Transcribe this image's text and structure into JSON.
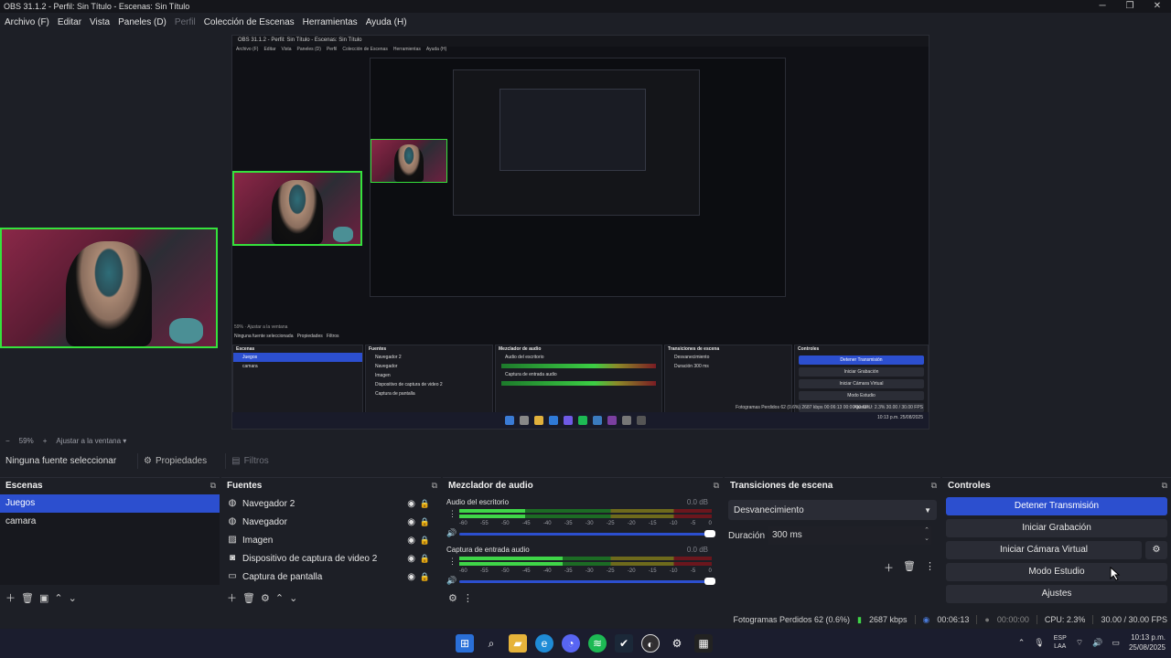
{
  "window": {
    "title": "OBS 31.1.2 - Perfil: Sin Título - Escenas: Sin Título",
    "minimize": "─",
    "maximize": "❐",
    "close": "✕"
  },
  "menu": {
    "archivo": "Archivo (F)",
    "editar": "Editar",
    "vista": "Vista",
    "paneles": "Paneles (D)",
    "perfil": "Perfil",
    "coleccion": "Colección de Escenas",
    "herramientas": "Herramientas",
    "ayuda": "Ayuda (H)"
  },
  "nested_preview": {
    "title": "OBS 31.1.2 - Perfil: Sin Título - Escenas: Sin Título",
    "menu": [
      "Archivo (F)",
      "Editar",
      "Vista",
      "Paneles (D)",
      "Perfil",
      "Colección de Escenas",
      "Herramientas",
      "Ayuda (H)"
    ],
    "zoom": "59%",
    "fit": "Ajustar a la ventana",
    "no_source": "Ninguna fuente seleccionada",
    "props": "Propiedades",
    "filters": "Filtros",
    "scenes_h": "Escenas",
    "scenes": [
      "Juegos",
      "camara"
    ],
    "sources_h": "Fuentes",
    "sources": [
      "Navegador 2",
      "Navegador",
      "Imagen",
      "Dispositivo de captura de video 2",
      "Captura de pantalla"
    ],
    "mixer_h": "Mezclador de audio",
    "mixer": [
      "Audio del escritorio",
      "Captura de entrada audio"
    ],
    "trans_h": "Transiciones de escena",
    "trans": "Desvanecimiento",
    "dur_lbl": "Duración",
    "dur": "300 ms",
    "ctl_h": "Controles",
    "ctl": [
      "Detener Transmisión",
      "Iniciar Grabación",
      "Iniciar Cámara Virtual",
      "Modo Estudio",
      "Ajustes"
    ],
    "status": "Fotogramas Perdidos 62 (0.6%)   2687 kbps   00:06:13   00:00:00   CPU: 2.3%   30.00 / 30.00 FPS",
    "clock": "10:13 p.m. 25/08/2025"
  },
  "zoombar": {
    "zoom": "59%",
    "plus": "+",
    "fit": "Ajustar a la ventana"
  },
  "sourcebar": {
    "none": "Ninguna fuente seleccionar",
    "props": "Propiedades",
    "filters": "Filtros"
  },
  "scenes": {
    "title": "Escenas",
    "items": [
      {
        "label": "Juegos",
        "selected": true
      },
      {
        "label": "camara",
        "selected": false
      }
    ]
  },
  "sources": {
    "title": "Fuentes",
    "items": [
      {
        "label": "Navegador 2",
        "icon": "globe-icon"
      },
      {
        "label": "Navegador",
        "icon": "globe-icon"
      },
      {
        "label": "Imagen",
        "icon": "image-icon"
      },
      {
        "label": "Dispositivo de captura de video 2",
        "icon": "camera-icon"
      },
      {
        "label": "Captura de pantalla",
        "icon": "monitor-icon"
      }
    ]
  },
  "mixer": {
    "title": "Mezclador de audio",
    "channels": [
      {
        "name": "Audio del escritorio",
        "db": "0.0 dB",
        "level": 0.26
      },
      {
        "name": "Captura de entrada audio",
        "db": "0.0 dB",
        "level": 0.41
      }
    ],
    "ticks": [
      "-60",
      "-55",
      "-50",
      "-45",
      "-40",
      "-35",
      "-30",
      "-25",
      "-20",
      "-15",
      "-10",
      "-5",
      "0"
    ]
  },
  "transitions": {
    "title": "Transiciones de escena",
    "selected": "Desvanecimiento",
    "duration_label": "Duración",
    "duration": "300 ms"
  },
  "controls": {
    "title": "Controles",
    "stop_stream": "Detener Transmisión",
    "start_recording": "Iniciar Grabación",
    "start_virtualcam": "Iniciar Cámara Virtual",
    "studio_mode": "Modo Estudio",
    "settings": "Ajustes"
  },
  "status": {
    "dropped": "Fotogramas Perdidos 62 (0.6%)",
    "bitrate": "2687 kbps",
    "stream_time": "00:06:13",
    "rec_time": "00:00:00",
    "cpu": "CPU: 2.3%",
    "fps": "30.00 / 30.00 FPS"
  },
  "taskbar": {
    "lang_top": "ESP",
    "lang_bottom": "LAA",
    "time": "10:13 p.m.",
    "date": "25/08/2025"
  },
  "colors": {
    "accent": "#2c4fcf",
    "camera_border": "#35e23c",
    "meter_green": "#3fd548"
  }
}
